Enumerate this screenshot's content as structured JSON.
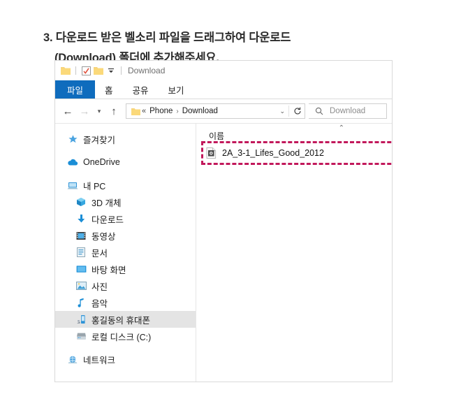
{
  "instruction": {
    "line1": "3. 다운로드 받은 벨소리 파일을 드래그하여 다운로드",
    "line2": "(Download) 폴더에 추가해주세요."
  },
  "window": {
    "title": "Download",
    "quick_access": [
      {
        "name": "folder-icon",
        "label": "폴더"
      },
      {
        "name": "properties-icon",
        "label": "속성"
      },
      {
        "name": "new-folder-icon",
        "label": "새 폴더"
      },
      {
        "name": "customize-dropdown-icon",
        "label": "빠른 실행 도구 모음 사용자 지정"
      }
    ],
    "tabs": [
      {
        "label": "파일",
        "selected": true
      },
      {
        "label": "홈",
        "selected": false
      },
      {
        "label": "공유",
        "selected": false
      },
      {
        "label": "보기",
        "selected": false
      }
    ]
  },
  "address_bar": {
    "back": "뒤로",
    "forward": "앞으로",
    "recent": "최근 위치",
    "up": "위로",
    "breadcrumb_prefix": "«",
    "crumbs": [
      "Phone",
      "Download"
    ],
    "crumb_separator": "›",
    "dropdown": "이전 위치",
    "refresh": "새로 고침",
    "search_placeholder": "Download"
  },
  "sidebar": {
    "items": [
      {
        "label": "즐겨찾기",
        "icon": "star-icon",
        "level": 0,
        "selected": false
      },
      {
        "label": "OneDrive",
        "icon": "cloud-icon",
        "level": 0,
        "selected": false
      },
      {
        "label": "내 PC",
        "icon": "computer-icon",
        "level": 0,
        "selected": false
      },
      {
        "label": "3D 개체",
        "icon": "cube-icon",
        "level": 1,
        "selected": false
      },
      {
        "label": "다운로드",
        "icon": "download-arrow-icon",
        "level": 1,
        "selected": false
      },
      {
        "label": "동영상",
        "icon": "video-icon",
        "level": 1,
        "selected": false
      },
      {
        "label": "문서",
        "icon": "document-icon",
        "level": 1,
        "selected": false
      },
      {
        "label": "바탕 화면",
        "icon": "desktop-icon",
        "level": 1,
        "selected": false
      },
      {
        "label": "사진",
        "icon": "pictures-icon",
        "level": 1,
        "selected": false
      },
      {
        "label": "음악",
        "icon": "music-note-icon",
        "level": 1,
        "selected": false
      },
      {
        "label": "홍길동의 휴대폰",
        "icon": "phone-icon",
        "level": 1,
        "selected": true
      },
      {
        "label": "로컬 디스크 (C:)",
        "icon": "disk-drive-icon",
        "level": 1,
        "selected": false
      },
      {
        "label": "네트워크",
        "icon": "network-icon",
        "level": 0,
        "selected": false
      }
    ]
  },
  "file_list": {
    "column_header": "이름",
    "collapse_ribbon": "리본 메뉴 축소",
    "rows": [
      {
        "name": "2A_3-1_Lifes_Good_2012",
        "icon": "media-file-icon"
      }
    ]
  },
  "annotation": {
    "color": "#c2185b",
    "style": "dashed-rectangle",
    "target": "2A_3-1_Lifes_Good_2012"
  },
  "colors": {
    "accent_tab": "#0f6cbd",
    "annotation": "#c2185b",
    "selection": "#e4e4e4",
    "text": "#1b1b1b"
  }
}
